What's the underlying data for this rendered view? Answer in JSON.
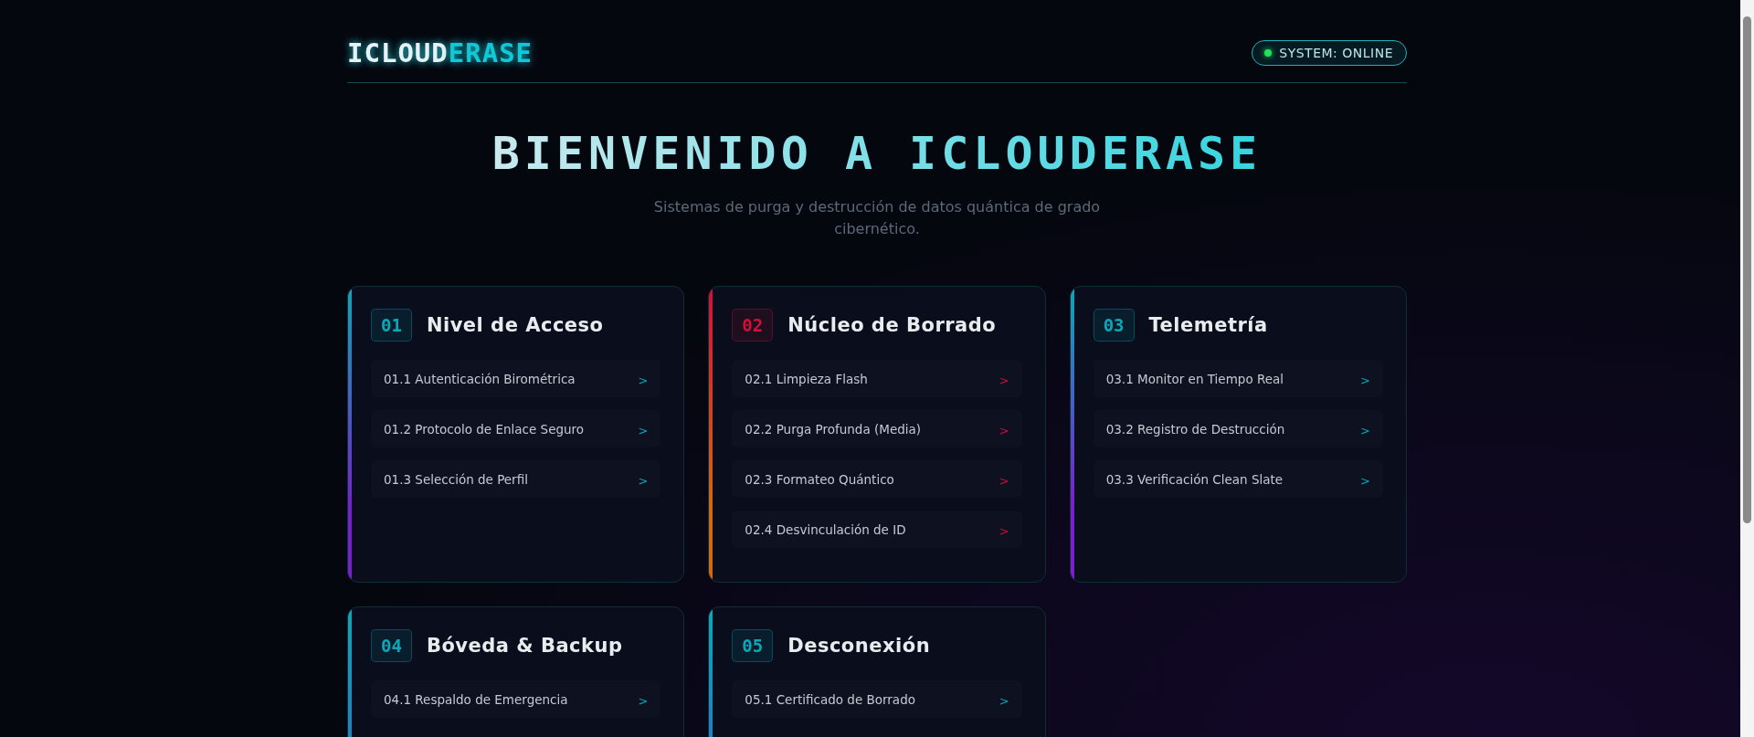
{
  "header": {
    "logo": {
      "part_1": "ICLOUD",
      "part_2": "ERASE"
    },
    "status": {
      "label": "SYSTEM: ONLINE",
      "online": true
    }
  },
  "hero": {
    "title": "BIENVENIDO A ICLOUDERASE",
    "subtitle": "Sistemas de purga y destrucción de datos quántica de grado cibernético."
  },
  "cards": [
    {
      "number": "01",
      "title": "Nivel de Acceso",
      "color": "#0aa8b8",
      "edge": {
        "color": "#7a1fd0"
      },
      "items": [
        "01.1 Autenticación Birométrica",
        "01.2 Protocolo de Enlace Seguro",
        "01.3 Selección de Perfil"
      ]
    },
    {
      "number": "02",
      "title": "Núcleo de Borrado",
      "color": "#d0103a",
      "edge": {
        "color": "#d06a10"
      },
      "items": [
        "02.1 Limpieza Flash",
        "02.2 Purga Profunda (Media)",
        "02.3 Formateo Quántico",
        "02.4 Desvinculación de ID"
      ]
    },
    {
      "number": "03",
      "title": "Telemetría",
      "color": "#0aa8b8",
      "edge": {
        "color": "#7a1fd0"
      },
      "items": [
        "03.1 Monitor en Tiempo Real",
        "03.2 Registro de Destrucción",
        "03.3 Verificación Clean Slate"
      ]
    },
    {
      "number": "04",
      "title": "Bóveda & Backup",
      "color": "#0aa8b8",
      "items": [
        "04.1 Respaldo de Emergencia"
      ]
    },
    {
      "number": "05",
      "title": "Desconexión",
      "color": "#0aa8b8",
      "items": [
        "05.1 Certificado de Borrado"
      ]
    }
  ],
  "item_marker": ">"
}
